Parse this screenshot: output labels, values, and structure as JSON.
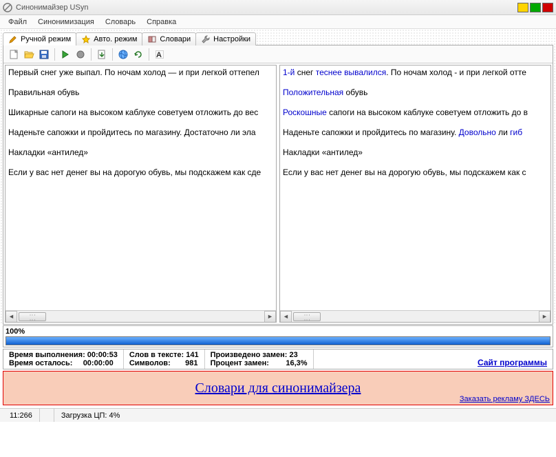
{
  "title": "Синонимайзер USyn",
  "menu": {
    "file": "Файл",
    "syn": "Синонимизация",
    "dict": "Словарь",
    "help": "Справка"
  },
  "tabs": {
    "manual": "Ручной режим",
    "auto": "Авто. режим",
    "dicts": "Словари",
    "settings": "Настройки"
  },
  "left": {
    "p1": "Первый снег уже выпал. По ночам холод — и при легкой оттепел",
    "p2": "Правильная обувь",
    "p3": "Шикарные сапоги на высоком каблуке советуем отложить до вес",
    "p4": "Наденьте сапожки и пройдитесь по магазину. Достаточно ли эла",
    "p5": "Накладки «антилед»",
    "p6": "Если у вас нет денег вы на дорогую обувь, мы подскажем как сде"
  },
  "right": {
    "p1a": "1-й",
    "p1b": " снег ",
    "p1c": "теснее вывалился",
    "p1d": ". По ночам холод - и при легкой отте",
    "p2a": "Положительная",
    "p2b": " обувь",
    "p3a": "Роскошные",
    "p3b": " сапоги на высоком каблуке советуем отложить до в",
    "p4a": "Наденьте сапожки и пройдитесь по магазину. ",
    "p4b": "Довольно",
    "p4c": " ли ",
    "p4d": "гиб",
    "p5": "Накладки «антилед»",
    "p6": "Если у вас нет денег вы на дорогую обувь, мы подскажем как с"
  },
  "progress": {
    "label": "100%",
    "value": 100
  },
  "stats": {
    "time_label": "Время выполнения:",
    "time_val": "00:00:53",
    "remain_label": "Время осталось:",
    "remain_val": "00:00:00",
    "words_label": "Слов в тексте:",
    "words_val": "141",
    "chars_label": "Символов:",
    "chars_val": "981",
    "repl_label": "Произведено замен:",
    "repl_val": "23",
    "pct_label": "Процент замен:",
    "pct_val": "16,3%",
    "site_link": "Сайт программы"
  },
  "banner": {
    "main": "Словари для синонимайзера",
    "order": "Заказать рекламу ЗДЕСЬ"
  },
  "status": {
    "pos": "11:266",
    "cpu": "Загрузка ЦП: 4%"
  }
}
